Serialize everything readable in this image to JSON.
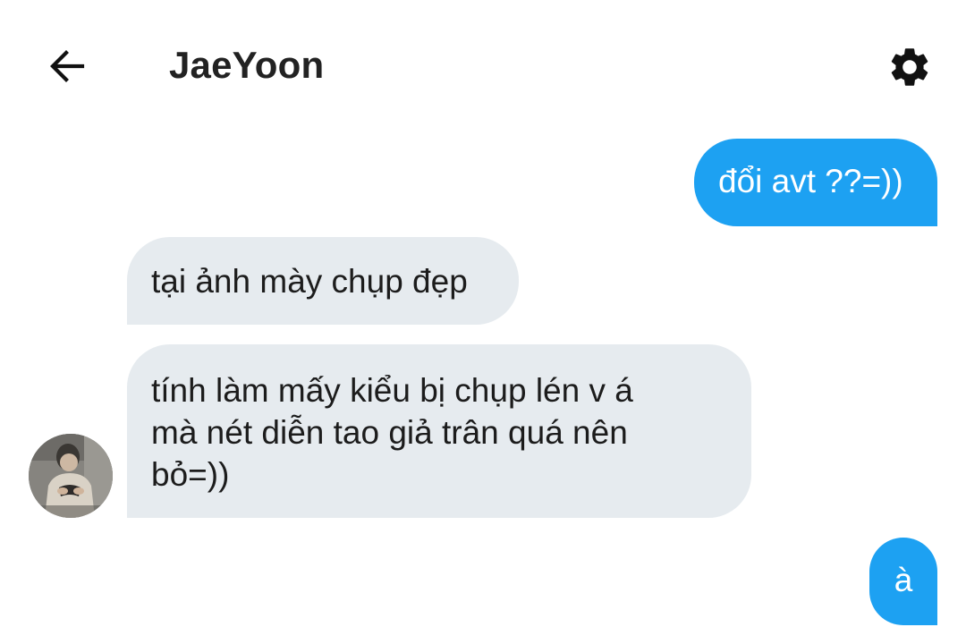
{
  "header": {
    "title": "JaeYoon"
  },
  "icons": {
    "back": "arrow-left-icon",
    "settings": "gear-icon"
  },
  "colors": {
    "outgoing_bubble": "#1da1f2",
    "incoming_bubble": "#e6ebef",
    "text_dark": "#1c1c1c"
  },
  "messages": [
    {
      "direction": "outgoing",
      "text": "đổi avt ??=))"
    },
    {
      "direction": "incoming",
      "text": "tại ảnh mày chụp đẹp"
    },
    {
      "direction": "incoming",
      "lines": [
        "tính làm mấy kiểu bị chụp lén v á",
        "mà nét diễn tao giả trân quá nên",
        "bỏ=))"
      ]
    },
    {
      "direction": "outgoing",
      "text": "à"
    }
  ]
}
